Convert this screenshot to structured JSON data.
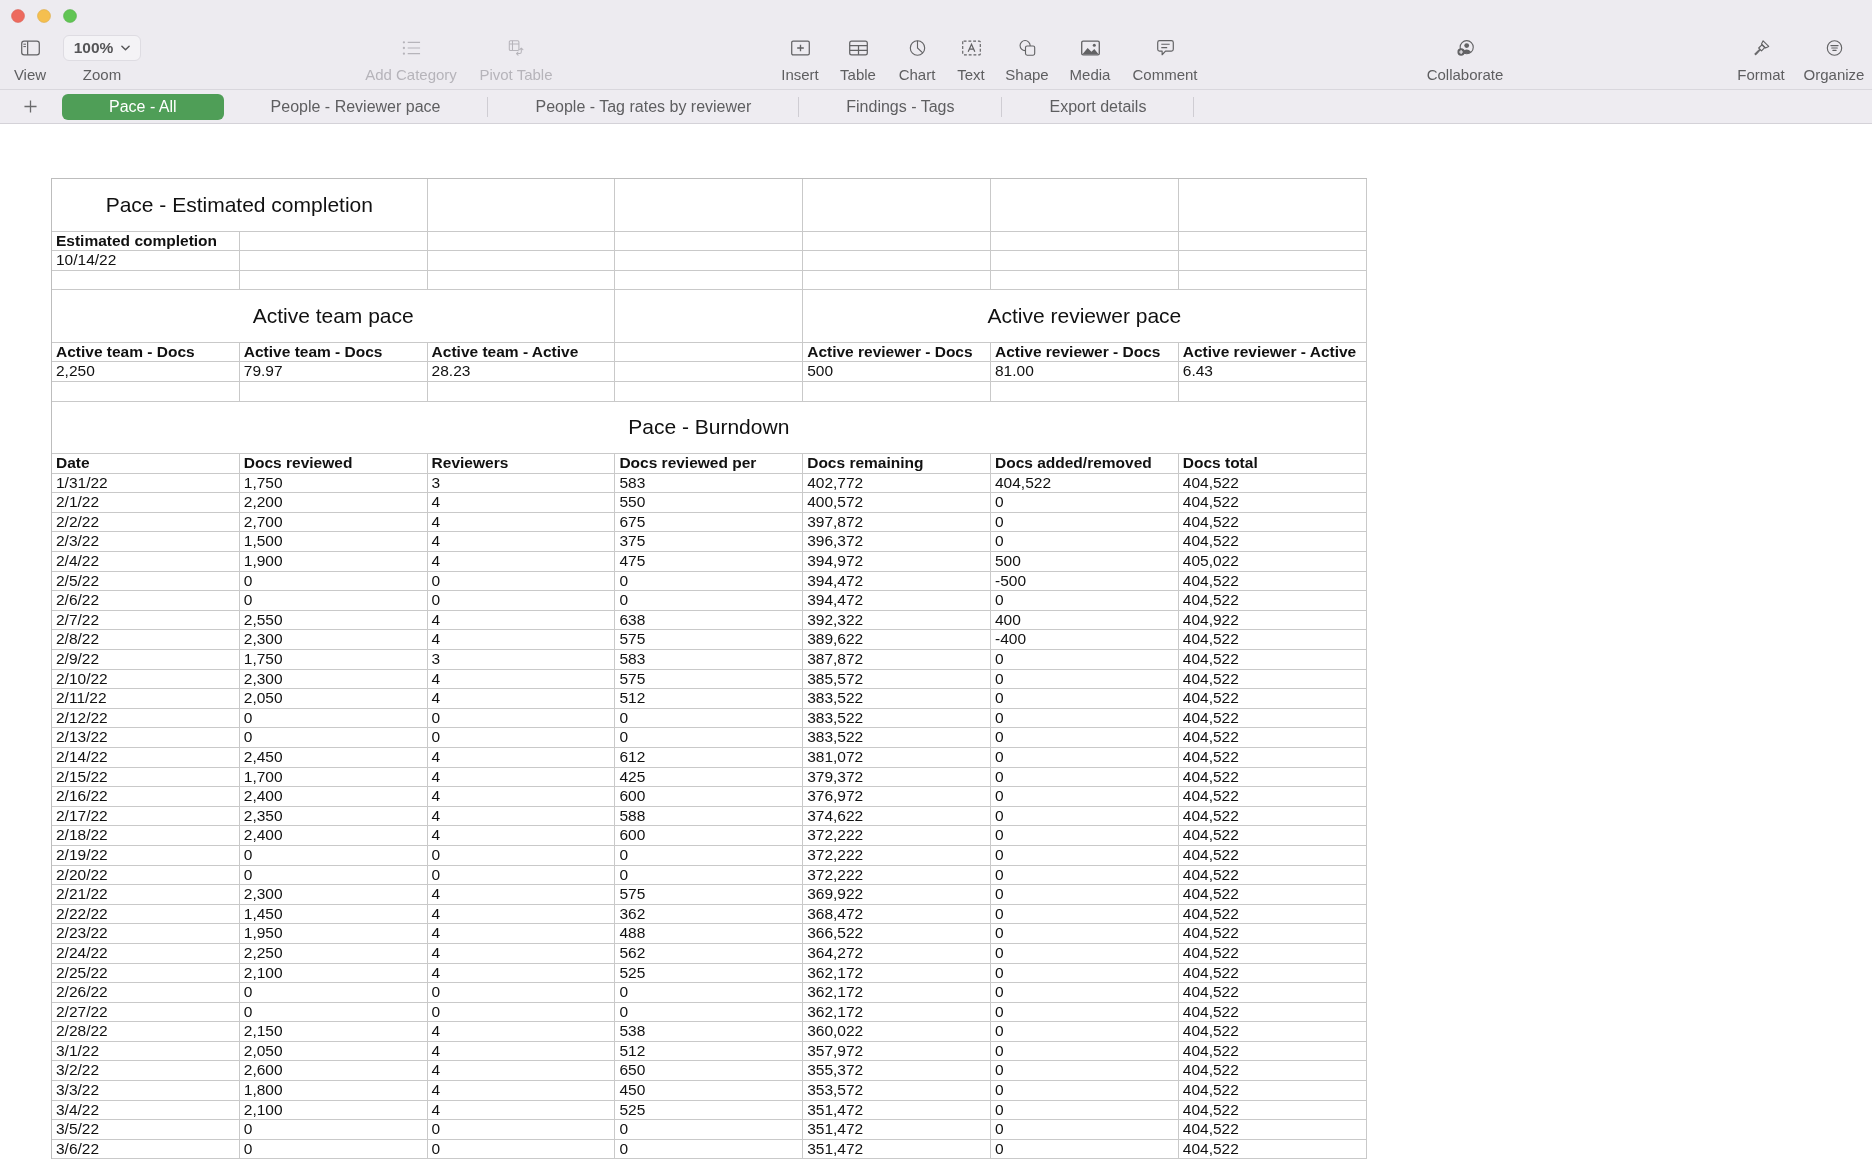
{
  "toolbar": {
    "items": [
      {
        "kind": "button",
        "label": "View",
        "disabled": false
      },
      {
        "kind": "dropdown",
        "label": "Zoom",
        "value": "100%",
        "disabled": false
      },
      {
        "kind": "button",
        "label": "Add Category",
        "disabled": true
      },
      {
        "kind": "button",
        "label": "Pivot Table",
        "disabled": true
      },
      {
        "kind": "button",
        "label": "Insert",
        "disabled": false
      },
      {
        "kind": "button",
        "label": "Table",
        "disabled": false
      },
      {
        "kind": "button",
        "label": "Chart",
        "disabled": false
      },
      {
        "kind": "button",
        "label": "Text",
        "disabled": false
      },
      {
        "kind": "button",
        "label": "Shape",
        "disabled": false
      },
      {
        "kind": "button",
        "label": "Media",
        "disabled": false
      },
      {
        "kind": "button",
        "label": "Comment",
        "disabled": false
      },
      {
        "kind": "button",
        "label": "Collaborate",
        "disabled": false
      },
      {
        "kind": "button",
        "label": "Format",
        "disabled": false
      },
      {
        "kind": "button",
        "label": "Organize",
        "disabled": false
      }
    ]
  },
  "sheets": {
    "tabs": [
      {
        "label": "Pace - All",
        "selected": true
      },
      {
        "label": "People - Reviewer pace",
        "selected": false
      },
      {
        "label": "People - Tag rates by reviewer",
        "selected": false
      },
      {
        "label": "Findings - Tags",
        "selected": false
      },
      {
        "label": "Export details",
        "selected": false
      }
    ]
  },
  "estimated_completion": {
    "title": "Pace - Estimated completion",
    "header": "Estimated completion",
    "value": "10/14/22"
  },
  "active_team_pace": {
    "title": "Active team pace",
    "headers": [
      "Active team - Docs",
      "Active team - Docs",
      "Active team - Active"
    ],
    "values": [
      "2,250",
      "79.97",
      "28.23"
    ]
  },
  "active_reviewer_pace": {
    "title": "Active reviewer pace",
    "headers": [
      "Active reviewer - Docs",
      "Active reviewer - Docs",
      "Active reviewer - Active"
    ],
    "values": [
      "500",
      "81.00",
      "6.43"
    ]
  },
  "burndown": {
    "title": "Pace - Burndown",
    "columns": [
      "Date",
      "Docs reviewed",
      "Reviewers",
      "Docs reviewed per",
      "Docs remaining",
      "Docs added/removed",
      "Docs total"
    ],
    "rows": [
      [
        "1/31/22",
        "1,750",
        "3",
        "583",
        "402,772",
        "404,522",
        "404,522"
      ],
      [
        "2/1/22",
        "2,200",
        "4",
        "550",
        "400,572",
        "0",
        "404,522"
      ],
      [
        "2/2/22",
        "2,700",
        "4",
        "675",
        "397,872",
        "0",
        "404,522"
      ],
      [
        "2/3/22",
        "1,500",
        "4",
        "375",
        "396,372",
        "0",
        "404,522"
      ],
      [
        "2/4/22",
        "1,900",
        "4",
        "475",
        "394,972",
        "500",
        "405,022"
      ],
      [
        "2/5/22",
        "0",
        "0",
        "0",
        "394,472",
        "-500",
        "404,522"
      ],
      [
        "2/6/22",
        "0",
        "0",
        "0",
        "394,472",
        "0",
        "404,522"
      ],
      [
        "2/7/22",
        "2,550",
        "4",
        "638",
        "392,322",
        "400",
        "404,922"
      ],
      [
        "2/8/22",
        "2,300",
        "4",
        "575",
        "389,622",
        "-400",
        "404,522"
      ],
      [
        "2/9/22",
        "1,750",
        "3",
        "583",
        "387,872",
        "0",
        "404,522"
      ],
      [
        "2/10/22",
        "2,300",
        "4",
        "575",
        "385,572",
        "0",
        "404,522"
      ],
      [
        "2/11/22",
        "2,050",
        "4",
        "512",
        "383,522",
        "0",
        "404,522"
      ],
      [
        "2/12/22",
        "0",
        "0",
        "0",
        "383,522",
        "0",
        "404,522"
      ],
      [
        "2/13/22",
        "0",
        "0",
        "0",
        "383,522",
        "0",
        "404,522"
      ],
      [
        "2/14/22",
        "2,450",
        "4",
        "612",
        "381,072",
        "0",
        "404,522"
      ],
      [
        "2/15/22",
        "1,700",
        "4",
        "425",
        "379,372",
        "0",
        "404,522"
      ],
      [
        "2/16/22",
        "2,400",
        "4",
        "600",
        "376,972",
        "0",
        "404,522"
      ],
      [
        "2/17/22",
        "2,350",
        "4",
        "588",
        "374,622",
        "0",
        "404,522"
      ],
      [
        "2/18/22",
        "2,400",
        "4",
        "600",
        "372,222",
        "0",
        "404,522"
      ],
      [
        "2/19/22",
        "0",
        "0",
        "0",
        "372,222",
        "0",
        "404,522"
      ],
      [
        "2/20/22",
        "0",
        "0",
        "0",
        "372,222",
        "0",
        "404,522"
      ],
      [
        "2/21/22",
        "2,300",
        "4",
        "575",
        "369,922",
        "0",
        "404,522"
      ],
      [
        "2/22/22",
        "1,450",
        "4",
        "362",
        "368,472",
        "0",
        "404,522"
      ],
      [
        "2/23/22",
        "1,950",
        "4",
        "488",
        "366,522",
        "0",
        "404,522"
      ],
      [
        "2/24/22",
        "2,250",
        "4",
        "562",
        "364,272",
        "0",
        "404,522"
      ],
      [
        "2/25/22",
        "2,100",
        "4",
        "525",
        "362,172",
        "0",
        "404,522"
      ],
      [
        "2/26/22",
        "0",
        "0",
        "0",
        "362,172",
        "0",
        "404,522"
      ],
      [
        "2/27/22",
        "0",
        "0",
        "0",
        "362,172",
        "0",
        "404,522"
      ],
      [
        "2/28/22",
        "2,150",
        "4",
        "538",
        "360,022",
        "0",
        "404,522"
      ],
      [
        "3/1/22",
        "2,050",
        "4",
        "512",
        "357,972",
        "0",
        "404,522"
      ],
      [
        "3/2/22",
        "2,600",
        "4",
        "650",
        "355,372",
        "0",
        "404,522"
      ],
      [
        "3/3/22",
        "1,800",
        "4",
        "450",
        "353,572",
        "0",
        "404,522"
      ],
      [
        "3/4/22",
        "2,100",
        "4",
        "525",
        "351,472",
        "0",
        "404,522"
      ],
      [
        "3/5/22",
        "0",
        "0",
        "0",
        "351,472",
        "0",
        "404,522"
      ],
      [
        "3/6/22",
        "0",
        "0",
        "0",
        "351,472",
        "0",
        "404,522"
      ]
    ]
  }
}
